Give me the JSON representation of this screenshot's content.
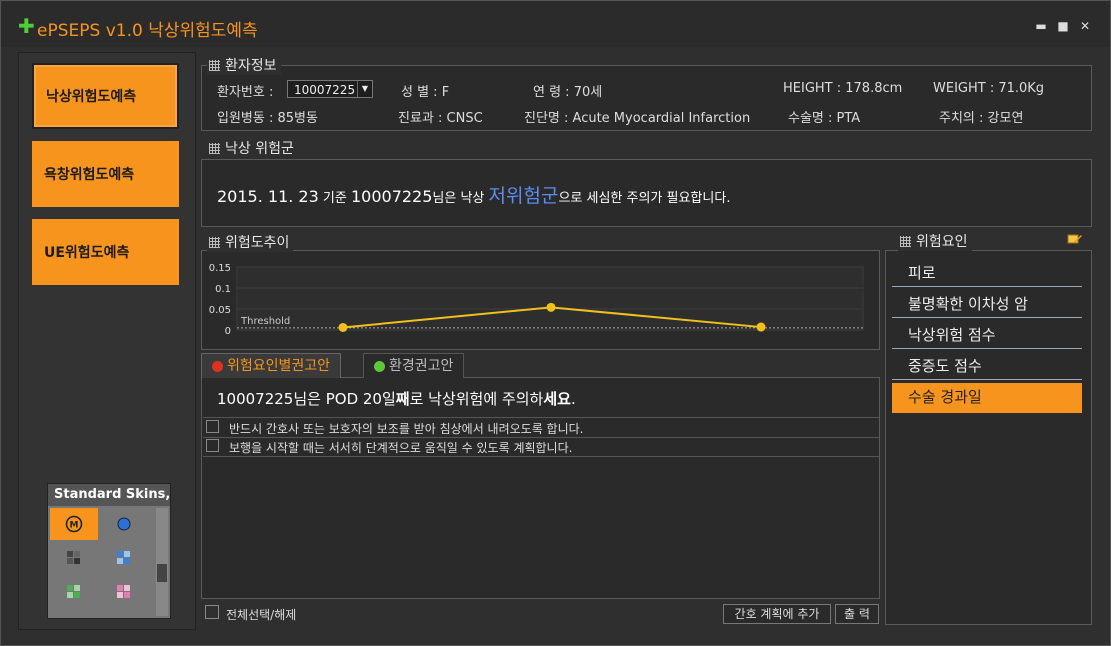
{
  "app": {
    "title": "ePSEPS v1.0 낙상위험도예측"
  },
  "window_controls": {
    "minimize": "▬",
    "maximize": "■",
    "close": "✕"
  },
  "nav": {
    "fall": "낙상위험도예측",
    "pressure": "욕창위험도예측",
    "ue": "UE위험도예측"
  },
  "skins": {
    "title": "Standard Skins,"
  },
  "patient": {
    "section_title": "환자정보",
    "id_label": "환자번호 :",
    "id_value": "10007225",
    "sex": "성  별 : F",
    "age": "연  령 : 70세",
    "height": "HEIGHT : 178.8cm",
    "weight": "WEIGHT : 71.0Kg",
    "ward": "입원병동 : 85병동",
    "dept": "진료과 : CNSC",
    "diagnosis": "진단명 : Acute Myocardial Infarction",
    "surgery": "수술명 : PTA",
    "doctor": "주치의 : 강모연"
  },
  "risk_group": {
    "section_title": "낙상 위험군",
    "date_part": "2015. 11. 23",
    "text1": " 기준 ",
    "pid": "10007225",
    "text2": "님은 낙상 ",
    "group": "저위험군",
    "text3": "으로 세심한 주의가 필요합니다."
  },
  "trend": {
    "section_title": "위험도추이"
  },
  "chart_data": {
    "type": "line",
    "title": "",
    "xlabel": "",
    "ylabel": "",
    "x": [
      1,
      2,
      3
    ],
    "series": [
      {
        "name": "",
        "values": [
          0.006,
          0.054,
          0.007
        ]
      }
    ],
    "yticks": [
      "0.15",
      "0.1",
      "0.05",
      "0"
    ],
    "ylim": [
      0,
      0.15
    ],
    "threshold_label": "Threshold",
    "threshold_value": 0.005,
    "line_color": "#f2c01a",
    "grid": true
  },
  "tabs": {
    "tab1": "위험요인별권고안",
    "tab2": "환경권고안"
  },
  "recommend": {
    "headline_pre": "10007225님은 POD 20일",
    "headline_bold": "째",
    "headline_post": "로 낙상위험에 주의하",
    "headline_bold2": "세요",
    "headline_end": ".",
    "items": [
      "반드시 간호사 또는 보호자의 보조를 받아 침상에서 내려오도록 합니다.",
      "보행을 시작할 때는 서서히 단계적으로 움직일 수 있도록 계획합니다."
    ]
  },
  "bottom": {
    "select_all": "전체선택/해제",
    "add_plan": "간호 계획에 추가",
    "print": "출 력"
  },
  "risk_factors": {
    "section_title": "위험요인",
    "items": [
      "피로",
      "불명확한 이차성 암",
      "낙상위험 점수",
      "중증도 점수",
      "수술 경과일"
    ]
  },
  "colors": {
    "accent": "#f7941d",
    "high_risk_text": "#5b8ef0",
    "tab_dot_red": "#e0301e",
    "tab_dot_green": "#5cc83a"
  }
}
